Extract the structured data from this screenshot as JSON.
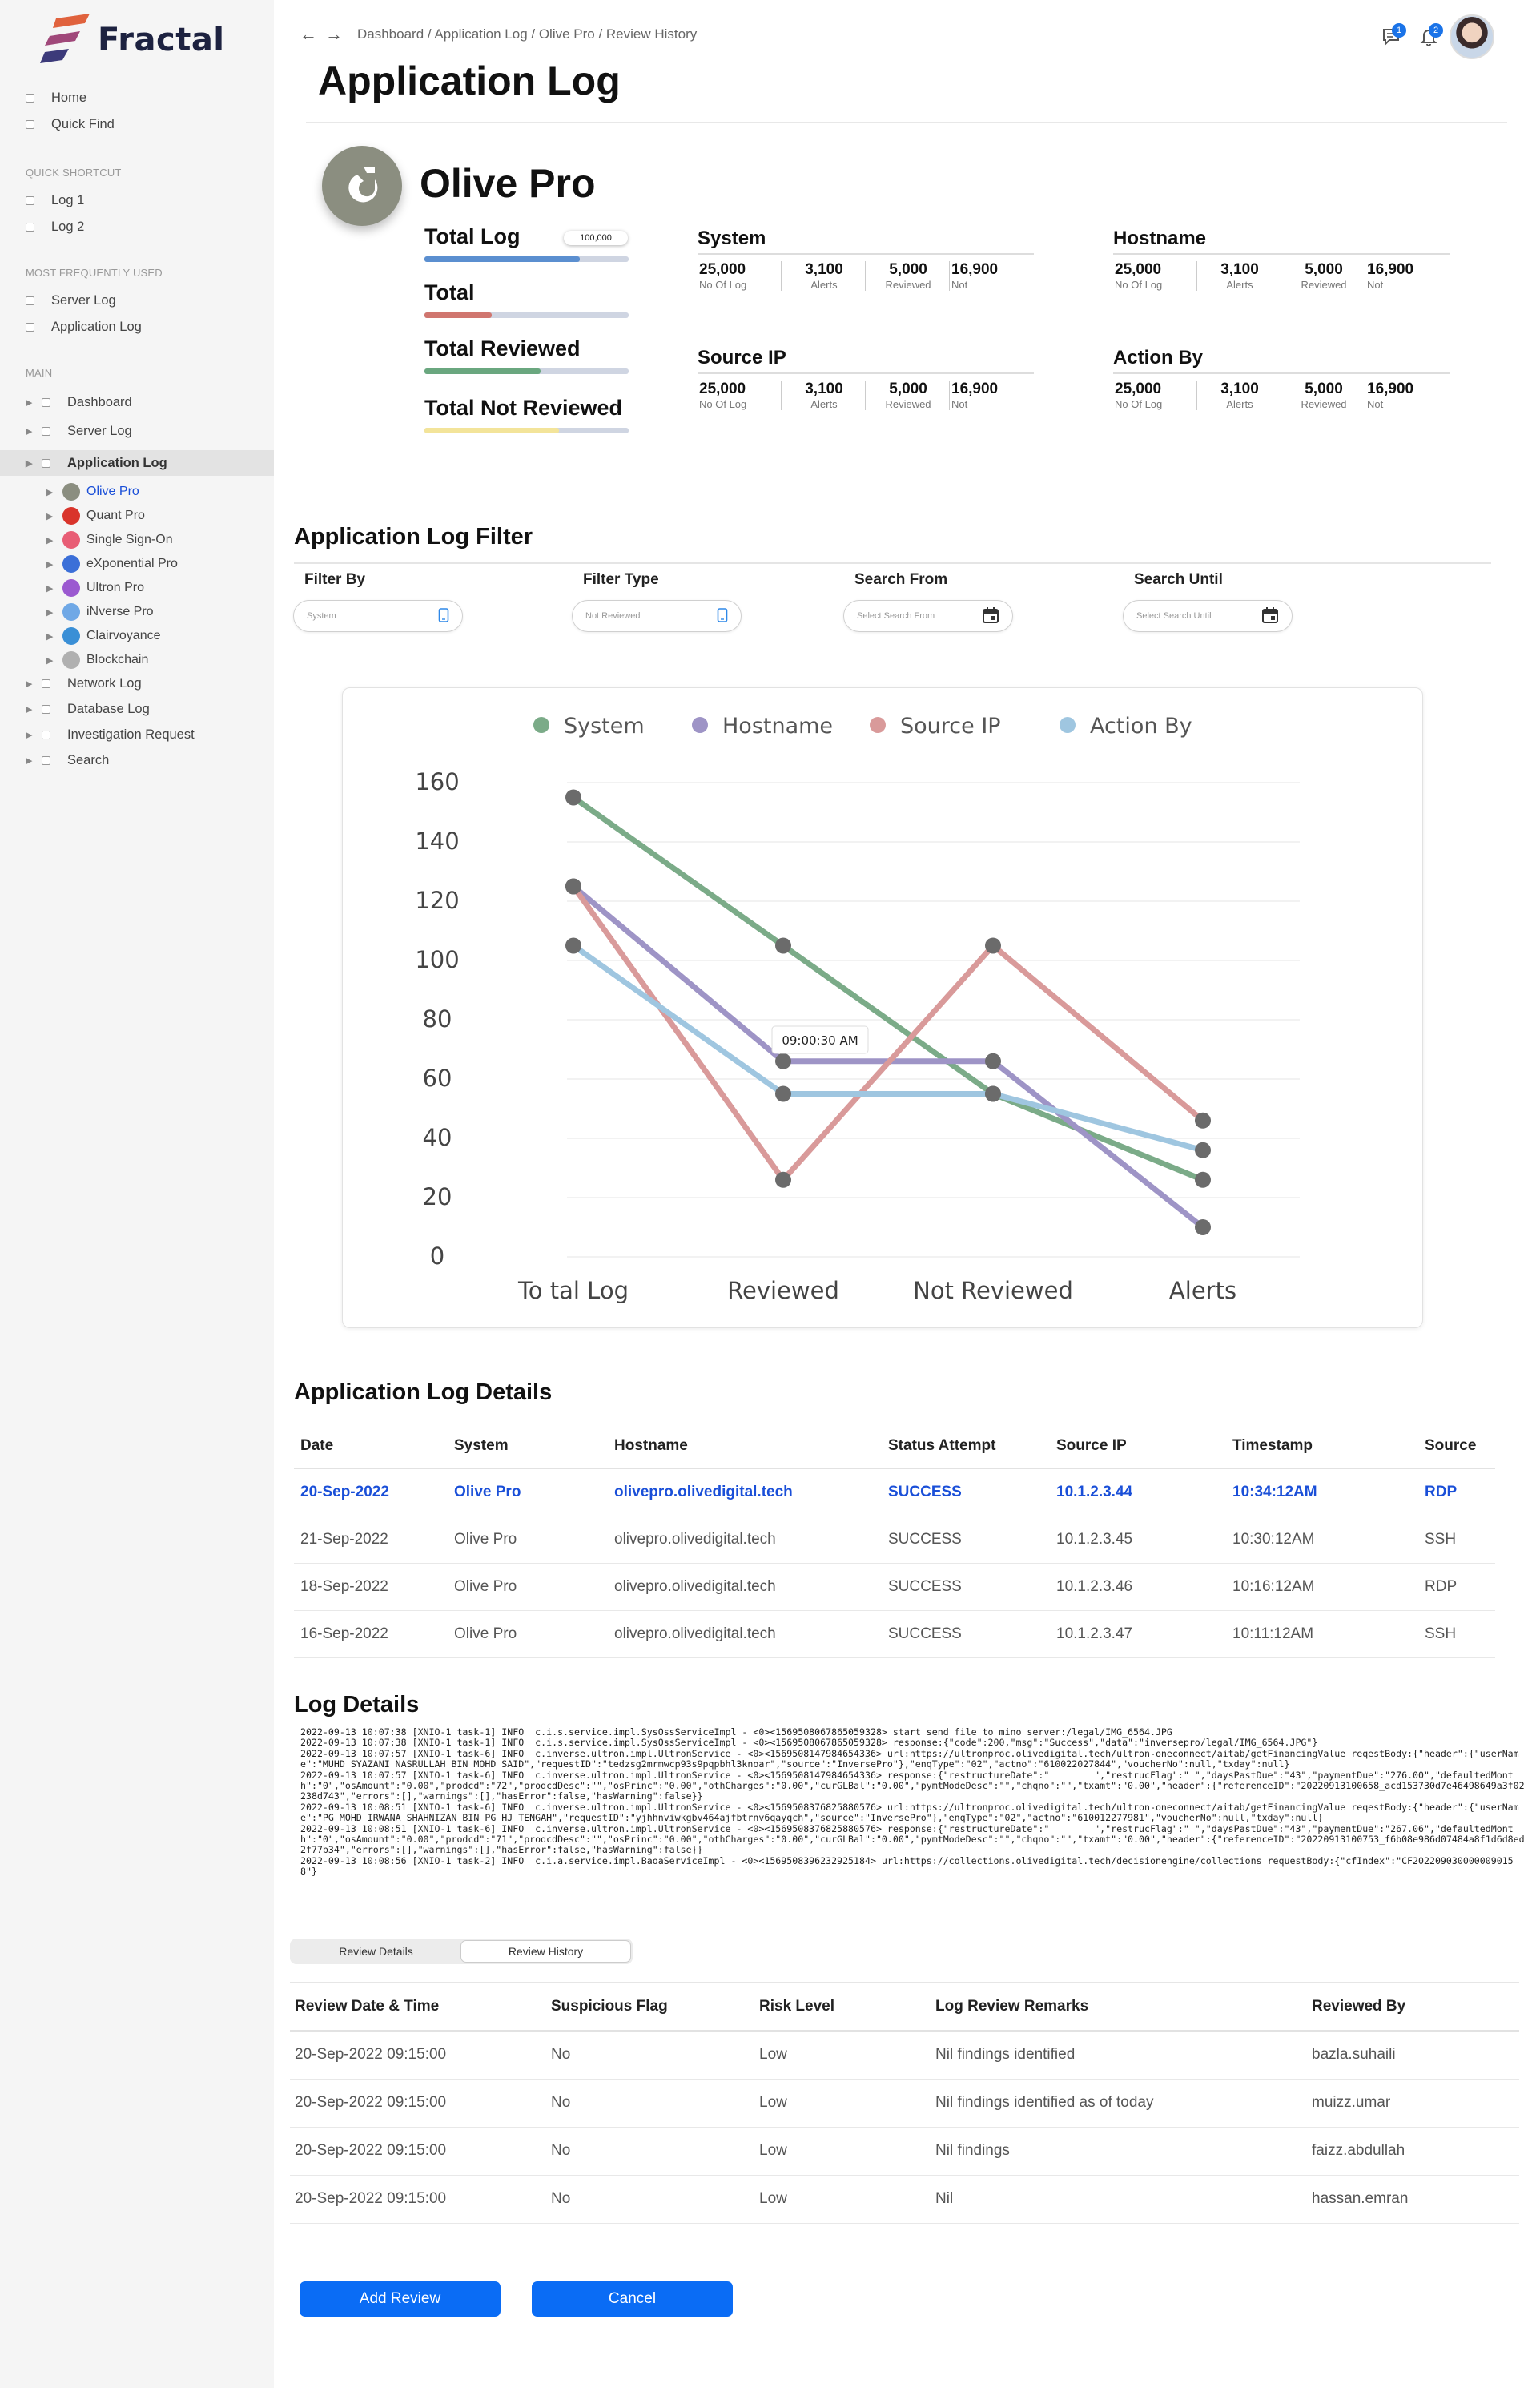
{
  "brand": {
    "name": "Fractal"
  },
  "sidebar": {
    "top": [
      {
        "label": "Home"
      },
      {
        "label": "Quick Find"
      }
    ],
    "quick_shortcut_title": "QUICK SHORTCUT",
    "quick": [
      {
        "label": "Log 1"
      },
      {
        "label": "Log 2"
      }
    ],
    "frequent_title": "MOST FREQUENTLY USED",
    "frequent": [
      {
        "label": "Server Log"
      },
      {
        "label": "Application Log"
      }
    ],
    "main_title": "MAIN",
    "main": [
      {
        "label": "Dashboard"
      },
      {
        "label": "Server Log"
      },
      {
        "label": "Application Log"
      }
    ],
    "apps": [
      {
        "label": "Olive Pro",
        "color": "#8b8e80"
      },
      {
        "label": "Quant Pro",
        "color": "#d9342b"
      },
      {
        "label": "Single Sign-On",
        "color": "#e85d75"
      },
      {
        "label": "eXponential Pro",
        "color": "#3b6fd8"
      },
      {
        "label": "Ultron Pro",
        "color": "#9b59d0"
      },
      {
        "label": "iNverse Pro",
        "color": "#6fa8e6"
      },
      {
        "label": "Clairvoyance",
        "color": "#3a8fd6"
      },
      {
        "label": "Blockchain",
        "color": "#b0b0b0"
      }
    ],
    "main_after": [
      {
        "label": "Network Log"
      },
      {
        "label": "Database Log"
      },
      {
        "label": "Investigation Request"
      },
      {
        "label": "Search"
      }
    ]
  },
  "header": {
    "breadcrumb": "Dashboard / Application Log / Olive Pro / Review History",
    "messages_count": "1",
    "notifications_count": "2",
    "title": "Application Log"
  },
  "product": {
    "name": "Olive Pro",
    "metrics": [
      {
        "label": "Total Log",
        "chip": "100,000",
        "fill": 0.76,
        "color": "#5b8fd0"
      },
      {
        "label": "Total",
        "fill": 0.33,
        "color": "#d0766f"
      },
      {
        "label": "Total Reviewed",
        "fill": 0.57,
        "color": "#6aa77f"
      },
      {
        "label": "Total Not Reviewed",
        "fill": 0.66,
        "color": "#f3e49a"
      }
    ],
    "groups": [
      {
        "title": "System",
        "stats": [
          {
            "v": "25,000",
            "k": "No Of Log"
          },
          {
            "v": "3,100",
            "k": "Alerts"
          },
          {
            "v": "5,000",
            "k": "Reviewed"
          },
          {
            "v": "16,900",
            "k": "Not"
          }
        ]
      },
      {
        "title": "Hostname",
        "stats": [
          {
            "v": "25,000",
            "k": "No Of Log"
          },
          {
            "v": "3,100",
            "k": "Alerts"
          },
          {
            "v": "5,000",
            "k": "Reviewed"
          },
          {
            "v": "16,900",
            "k": "Not"
          }
        ]
      },
      {
        "title": "Source IP",
        "stats": [
          {
            "v": "25,000",
            "k": "No Of Log"
          },
          {
            "v": "3,100",
            "k": "Alerts"
          },
          {
            "v": "5,000",
            "k": "Reviewed"
          },
          {
            "v": "16,900",
            "k": "Not"
          }
        ]
      },
      {
        "title": "Action By",
        "stats": [
          {
            "v": "25,000",
            "k": "No Of Log"
          },
          {
            "v": "3,100",
            "k": "Alerts"
          },
          {
            "v": "5,000",
            "k": "Reviewed"
          },
          {
            "v": "16,900",
            "k": "Not"
          }
        ]
      }
    ]
  },
  "filter": {
    "title": "Application Log Filter",
    "fields": [
      {
        "label": "Filter By",
        "placeholder": "System",
        "icon": "phone-icon"
      },
      {
        "label": "Filter Type",
        "placeholder": "Not Reviewed",
        "icon": "phone-icon"
      },
      {
        "label": "Search From",
        "placeholder": "Select Search From",
        "icon": "calendar-icon"
      },
      {
        "label": "Search Until",
        "placeholder": "Select Search Until",
        "icon": "calendar-icon"
      }
    ]
  },
  "chart_data": {
    "type": "line",
    "categories": [
      "To tal Log",
      "Reviewed",
      "Not Reviewed",
      "Alerts"
    ],
    "series": [
      {
        "name": "System",
        "color": "#7bab88",
        "values": [
          155,
          105,
          55,
          26
        ]
      },
      {
        "name": "Hostname",
        "color": "#9e94c6",
        "values": [
          125,
          66,
          66,
          10
        ]
      },
      {
        "name": "Source IP",
        "color": "#d99a9a",
        "values": [
          125,
          26,
          105,
          46
        ]
      },
      {
        "name": "Action By",
        "color": "#9fc6e0",
        "values": [
          105,
          55,
          55,
          36
        ]
      }
    ],
    "ylim": [
      0,
      160
    ],
    "yticks": [
      0,
      20,
      40,
      60,
      80,
      100,
      120,
      140,
      160
    ],
    "grid": true,
    "legend": "top",
    "tooltip": "09:00:30 AM"
  },
  "details": {
    "title": "Application Log Details",
    "columns": [
      "Date",
      "System",
      "Hostname",
      "Status Attempt",
      "Source IP",
      "Timestamp",
      "Source"
    ],
    "rows": [
      [
        "20-Sep-2022",
        "Olive Pro",
        "olivepro.olivedigital.tech",
        "SUCCESS",
        "10.1.2.3.44",
        "10:34:12AM",
        "RDP"
      ],
      [
        "21-Sep-2022",
        "Olive Pro",
        "olivepro.olivedigital.tech",
        "SUCCESS",
        "10.1.2.3.45",
        "10:30:12AM",
        "SSH"
      ],
      [
        "18-Sep-2022",
        "Olive Pro",
        "olivepro.olivedigital.tech",
        "SUCCESS",
        "10.1.2.3.46",
        "10:16:12AM",
        "RDP"
      ],
      [
        "16-Sep-2022",
        "Olive Pro",
        "olivepro.olivedigital.tech",
        "SUCCESS",
        "10.1.2.3.47",
        "10:11:12AM",
        "SSH"
      ]
    ]
  },
  "log": {
    "title": "Log Details",
    "text": "2022-09-13 10:07:38 [XNIO-1 task-1] INFO  c.i.s.service.impl.SysOssServiceImpl - <0><1569508067865059328> start send file to mino server:/legal/IMG_6564.JPG\n2022-09-13 10:07:38 [XNIO-1 task-1] INFO  c.i.s.service.impl.SysOssServiceImpl - <0><1569508067865059328> response:{\"code\":200,\"msg\":\"Success\",\"data\":\"inversepro/legal/IMG_6564.JPG\"}\n2022-09-13 10:07:57 [XNIO-1 task-6] INFO  c.inverse.ultron.impl.UltronService - <0><1569508147984654336> url:https://ultronproc.olivedigital.tech/ultron-oneconnect/aitab/getFinancingValue reqestBody:{\"header\":{\"userName\":\"MUHD SYAZANI NASRULLAH BIN MOHD SAID\",\"requestID\":\"tedzsg2mrmwcp93s9pqpbhl3knoar\",\"source\":\"InversePro\"},\"enqType\":\"02\",\"actno\":\"610022027844\",\"voucherNo\":null,\"txday\":null}\n2022-09-13 10:07:57 [XNIO-1 task-6] INFO  c.inverse.ultron.impl.UltronService - <0><1569508147984654336> response:{\"restructureDate\":\"        \",\"restrucFlag\":\" \",\"daysPastDue\":\"43\",\"paymentDue\":\"276.00\",\"defaultedMonth\":\"0\",\"osAmount\":\"0.00\",\"prodcd\":\"72\",\"prodcdDesc\":\"\",\"osPrinc\":\"0.00\",\"othCharges\":\"0.00\",\"curGLBal\":\"0.00\",\"pymtModeDesc\":\"\",\"chqno\":\"\",\"txamt\":\"0.00\",\"header\":{\"referenceID\":\"20220913100658_acd153730d7e46498649a3f02238d743\",\"errors\":[],\"warnings\":[],\"hasError\":false,\"hasWarning\":false}}\n2022-09-13 10:08:51 [XNIO-1 task-6] INFO  c.inverse.ultron.impl.UltronService - <0><1569508376825880576> url:https://ultronproc.olivedigital.tech/ultron-oneconnect/aitab/getFinancingValue reqestBody:{\"header\":{\"userName\":\"PG MOHD IRWANA SHAHNIZAN BIN PG HJ TENGAH\",\"requestID\":\"yjhhnviwkgbv464ajfbtrnv6qayqch\",\"source\":\"InversePro\"},\"enqType\":\"02\",\"actno\":\"610012277981\",\"voucherNo\":null,\"txday\":null}\n2022-09-13 10:08:51 [XNIO-1 task-6] INFO  c.inverse.ultron.impl.UltronService - <0><1569508376825880576> response:{\"restructureDate\":\"        \",\"restrucFlag\":\" \",\"daysPastDue\":\"43\",\"paymentDue\":\"267.06\",\"defaultedMonth\":\"0\",\"osAmount\":\"0.00\",\"prodcd\":\"71\",\"prodcdDesc\":\"\",\"osPrinc\":\"0.00\",\"othCharges\":\"0.00\",\"curGLBal\":\"0.00\",\"pymtModeDesc\":\"\",\"chqno\":\"\",\"txamt\":\"0.00\",\"header\":{\"referenceID\":\"20220913100753_f6b08e986d07484a8f1d6d8ed2f77b34\",\"errors\":[],\"warnings\":[],\"hasError\":false,\"hasWarning\":false}}\n2022-09-13 10:08:56 [XNIO-1 task-2] INFO  c.i.a.service.impl.BaoaServiceImpl - <0><1569508396232925184> url:https://collections.olivedigital.tech/decisionengine/collections requestBody:{\"cfIndex\":\"CF2022090300000090158\"}"
  },
  "review_tabs": [
    {
      "label": "Review Details"
    },
    {
      "label": "Review History"
    }
  ],
  "review": {
    "columns": [
      "Review Date & Time",
      "Suspicious Flag",
      "Risk Level",
      "Log Review Remarks",
      "Reviewed By"
    ],
    "rows": [
      [
        "20-Sep-2022 09:15:00",
        "No",
        "Low",
        "Nil findings identified",
        "bazla.suhaili"
      ],
      [
        "20-Sep-2022 09:15:00",
        "No",
        "Low",
        "Nil findings identified as of today",
        "muizz.umar"
      ],
      [
        "20-Sep-2022 09:15:00",
        "No",
        "Low",
        "Nil findings",
        "faizz.abdullah"
      ],
      [
        "20-Sep-2022 09:15:00",
        "No",
        "Low",
        "Nil",
        "hassan.emran"
      ]
    ]
  },
  "actions": {
    "add": "Add Review",
    "cancel": "Cancel"
  }
}
